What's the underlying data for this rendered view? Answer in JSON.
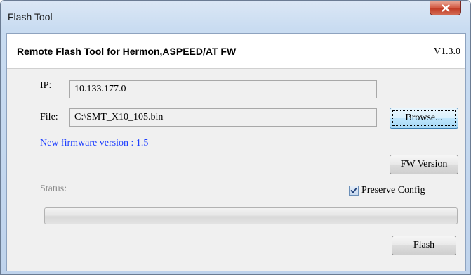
{
  "window": {
    "title": "Flash Tool"
  },
  "header": {
    "title": "Remote Flash Tool for Hermon,ASPEED/AT FW",
    "version": "V1.3.0"
  },
  "form": {
    "ip_label": "IP:",
    "ip_value": "10.133.177.0",
    "file_label": "File:",
    "file_value": "C:\\SMT_X10_105.bin",
    "browse_label": "Browse...",
    "firmware_info": "New firmware version : 1.5",
    "fw_version_label": "FW Version",
    "status_label": "Status:",
    "preserve_config_label": "Preserve Config",
    "preserve_config_checked": true,
    "progress": 0,
    "flash_label": "Flash"
  },
  "colors": {
    "firmware_info": "#1e3fff",
    "status_label": "#8a8a8a",
    "close_button": "#c9432c"
  },
  "icons": {
    "close": "close-icon",
    "check": "checkmark-icon"
  }
}
